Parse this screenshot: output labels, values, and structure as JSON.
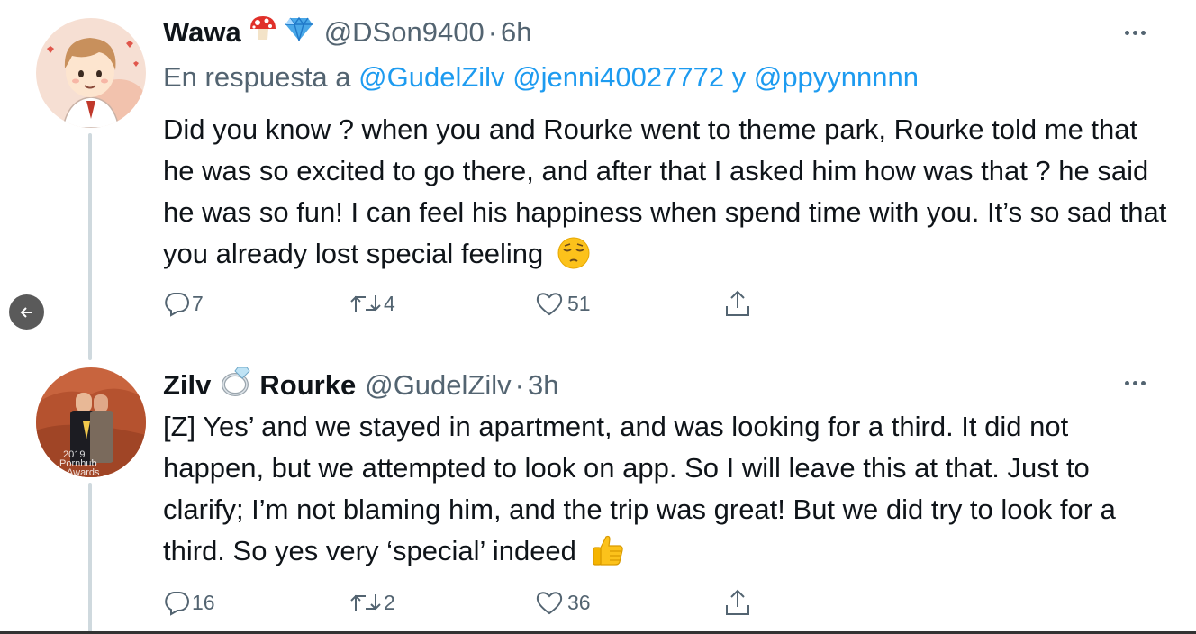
{
  "tweet1": {
    "display_name": "Wawa",
    "name_emojis": [
      "mushroom-icon",
      "gem-icon"
    ],
    "handle": "@DSon9400",
    "separator": "·",
    "time": "6h",
    "reply_prefix": "En respuesta a",
    "mention_1": "@GudelZilv",
    "mention_2": "@jenni40027772",
    "reply_joiner": "y",
    "mention_3": "@ppyynnnnn",
    "text": "Did you know ? when you and Rourke went to theme park, Rourke told me that he was so excited to go there, and after that I asked him how was that ? he said he was so fun! I can feel his happiness when spend time with you. It’s so sad that you already lost special feeling",
    "trailing_emoji": "pensive-face-icon",
    "replies": "7",
    "retweets": "4",
    "likes": "51"
  },
  "tweet2": {
    "name_part1": "Zilv",
    "name_emoji": "ring-icon",
    "name_part2": "Rourke",
    "handle": "@GudelZilv",
    "separator": "·",
    "time": "3h",
    "avatar_text_1": "2019",
    "avatar_text_2": "Pornhub",
    "avatar_text_3": "Awards",
    "text": "[Z] Yes’ and we stayed in apartment, and was looking for a third. It did not happen, but we attempted to look on app. So I will leave this at that. Just to clarify; I’m not blaming him, and the trip was great! But we did try to look for a third. So yes very ‘special’ indeed",
    "trailing_emoji": "thumbs-up-icon",
    "replies": "16",
    "retweets": "2",
    "likes": "36"
  },
  "colors": {
    "link": "#1d9bf0",
    "secondary": "#536471",
    "thread_line": "#cfd9de"
  }
}
